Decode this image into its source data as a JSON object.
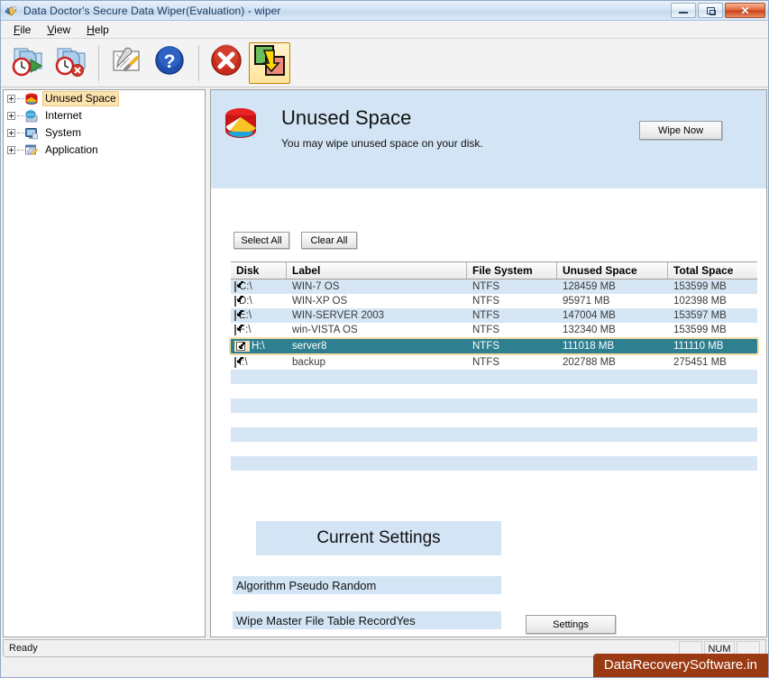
{
  "window": {
    "title": "Data Doctor's Secure Data Wiper(Evaluation) - wiper",
    "icon": "app-wiper-icon",
    "minimize_label": "—",
    "maximize_label": "❐",
    "close_label": "✕"
  },
  "menu": [
    {
      "label": "File",
      "accel": "F"
    },
    {
      "label": "View",
      "accel": "V"
    },
    {
      "label": "Help",
      "accel": "H"
    }
  ],
  "toolbar": {
    "buttons": [
      {
        "name": "schedule-wipe-icon",
        "title": "Schedule Wipe"
      },
      {
        "name": "remove-schedule-icon",
        "title": "Remove Schedule"
      },
      {
        "name": "tools-settings-icon",
        "title": "Tools"
      },
      {
        "name": "help-icon",
        "title": "Help"
      },
      {
        "name": "stop-icon",
        "title": "Stop"
      },
      {
        "name": "swap-wipe-icon",
        "title": "Wipe"
      }
    ]
  },
  "sidebar": {
    "items": [
      {
        "label": "Unused Space",
        "icon": "disk-red-icon",
        "selected": true
      },
      {
        "label": "Internet",
        "icon": "internet-globe-icon",
        "selected": false
      },
      {
        "label": "System",
        "icon": "system-monitor-icon",
        "selected": false
      },
      {
        "label": "Application",
        "icon": "application-window-icon",
        "selected": false
      }
    ]
  },
  "banner": {
    "icon": "disk-red-icon",
    "title": "Unused Space",
    "subtitle": "You may wipe unused space on your disk.",
    "wipe_button": "Wipe Now"
  },
  "actions": {
    "select_all": "Select All",
    "clear_all": "Clear All"
  },
  "table": {
    "columns": [
      "Disk",
      "Label",
      "File System",
      "Unused Space",
      "Total Space"
    ],
    "rows": [
      {
        "checked": true,
        "disk": "C:\\",
        "label": "WIN-7 OS",
        "fs": "NTFS",
        "unused": "128459 MB",
        "total": "153599 MB",
        "selected": false
      },
      {
        "checked": true,
        "disk": "D:\\",
        "label": "WIN-XP OS",
        "fs": "NTFS",
        "unused": "95971 MB",
        "total": "102398 MB",
        "selected": false
      },
      {
        "checked": true,
        "disk": "E:\\",
        "label": "WIN-SERVER 2003",
        "fs": "NTFS",
        "unused": "147004 MB",
        "total": "153597 MB",
        "selected": false
      },
      {
        "checked": true,
        "disk": "F:\\",
        "label": "win-VISTA OS",
        "fs": "NTFS",
        "unused": "132340 MB",
        "total": "153599 MB",
        "selected": false
      },
      {
        "checked": true,
        "disk": "H:\\",
        "label": "server8",
        "fs": "NTFS",
        "unused": "111018 MB",
        "total": "111110 MB",
        "selected": true
      },
      {
        "checked": true,
        "disk": "I:\\",
        "label": "backup",
        "fs": "NTFS",
        "unused": "202788 MB",
        "total": "275451 MB",
        "selected": false
      }
    ],
    "blank_row_count": 8
  },
  "current_settings": {
    "heading": "Current Settings",
    "algorithm_line": "Algorithm Pseudo Random",
    "mft_line": "Wipe Master File Table RecordYes",
    "settings_button": "Settings"
  },
  "statusbar": {
    "message": "Ready",
    "indicator_caps": "",
    "indicator_num": "NUM",
    "indicator_scrl": ""
  },
  "watermark": {
    "text": "DataRecoverySoftware.in"
  },
  "colors": {
    "selected_row_bg": "#2e7f8f",
    "selected_row_border": "#f3dda6",
    "banner_bg": "#d3e5f5",
    "stripe_bg": "#d6e6f5",
    "tree_selected_bg": "#fde3ae",
    "watermark_bg": "#9a3a12",
    "close_button": "#c6441c"
  }
}
